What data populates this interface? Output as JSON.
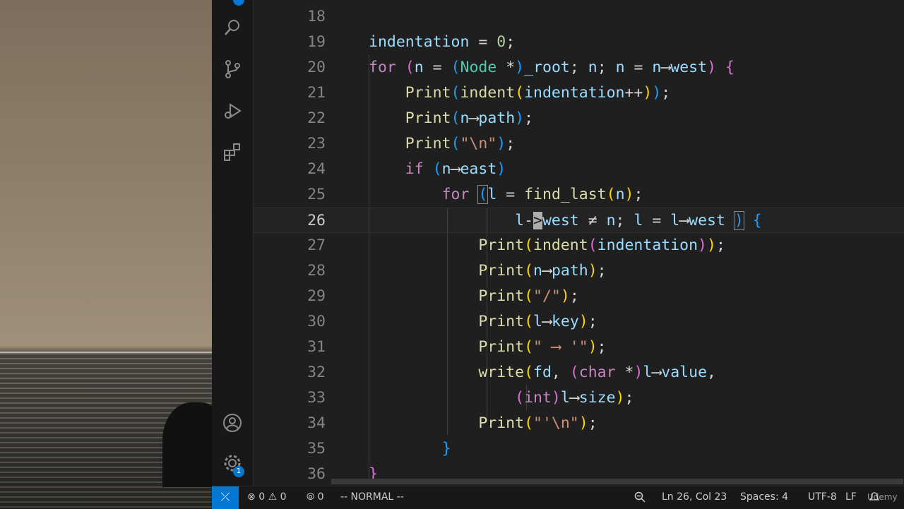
{
  "editor": {
    "lines": [
      {
        "n": "18"
      },
      {
        "n": "19"
      },
      {
        "n": "20"
      },
      {
        "n": "21"
      },
      {
        "n": "22"
      },
      {
        "n": "23"
      },
      {
        "n": "24"
      },
      {
        "n": "25"
      },
      {
        "n": "26"
      },
      {
        "n": "27"
      },
      {
        "n": "28"
      },
      {
        "n": "29"
      },
      {
        "n": "30"
      },
      {
        "n": "31"
      },
      {
        "n": "32"
      },
      {
        "n": "33"
      },
      {
        "n": "34"
      },
      {
        "n": "35"
      },
      {
        "n": "36"
      }
    ],
    "current_line": "26"
  },
  "activity_bar": {
    "icons": [
      "search-icon",
      "source-control-icon",
      "run-debug-icon",
      "extensions-icon",
      "account-icon",
      "settings-icon"
    ],
    "settings_badge": "1"
  },
  "statusbar": {
    "errors": "0",
    "warnings": "0",
    "ports": "0",
    "mode": "-- NORMAL --",
    "position": "Ln 26, Col 23",
    "spaces": "Spaces: 4",
    "encoding": "UTF-8",
    "eol": "LF"
  },
  "watermark": "Udemy",
  "colors": {
    "accent": "#0078d4",
    "background": "#1f1f1f",
    "keyword": "#c586c0",
    "function": "#dcdcaa",
    "variable": "#9cdcfe"
  }
}
